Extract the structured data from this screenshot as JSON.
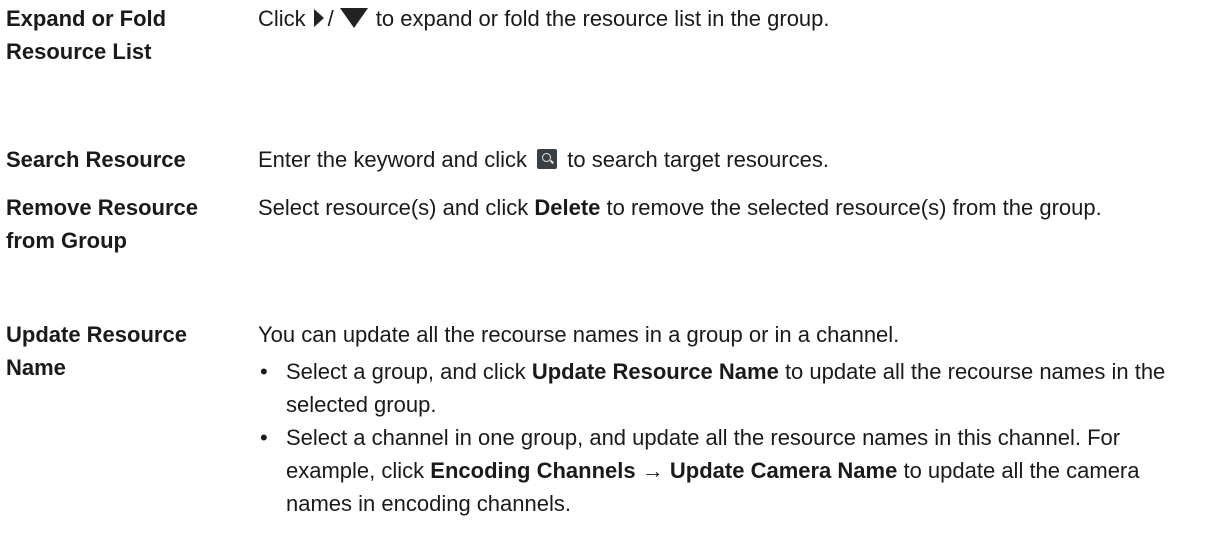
{
  "rows": [
    {
      "term": "Expand or Fold Resource List",
      "desc_before": "Click",
      "desc_sep": "/",
      "desc_after": "to expand or fold the resource list in the group.",
      "icons": [
        "expand-triangle-icon",
        "fold-triangle-icon"
      ]
    },
    {
      "term": "Search Resource",
      "desc_before": "Enter the keyword and click",
      "desc_after": "to search target resources.",
      "icons": [
        "search-icon"
      ]
    },
    {
      "term": "Remove Resource from Group",
      "desc_before": "Select resource(s) and click",
      "desc_bold": "Delete",
      "desc_after": "to remove the selected resource(s) from the group."
    },
    {
      "term": "Update Resource Name",
      "desc_intro": "You can update all the recourse names in a group or in a channel.",
      "bullets": [
        {
          "dot": "•",
          "before": "Select a group, and click",
          "bold": "Update Resource Name",
          "after": "to update all the recourse names in the selected group."
        },
        {
          "dot": "•",
          "before": "Select a channel in one group, and update all the resource names in this channel. For example, click",
          "bold1": "Encoding Channels",
          "arrow": "→",
          "bold2": "Update Camera Name",
          "after": "to update all the camera names in encoding channels."
        }
      ]
    }
  ],
  "colors": {
    "text": "#1a1a1a",
    "icon_dark": "#222222",
    "search_icon_bg": "#3a3f44"
  }
}
